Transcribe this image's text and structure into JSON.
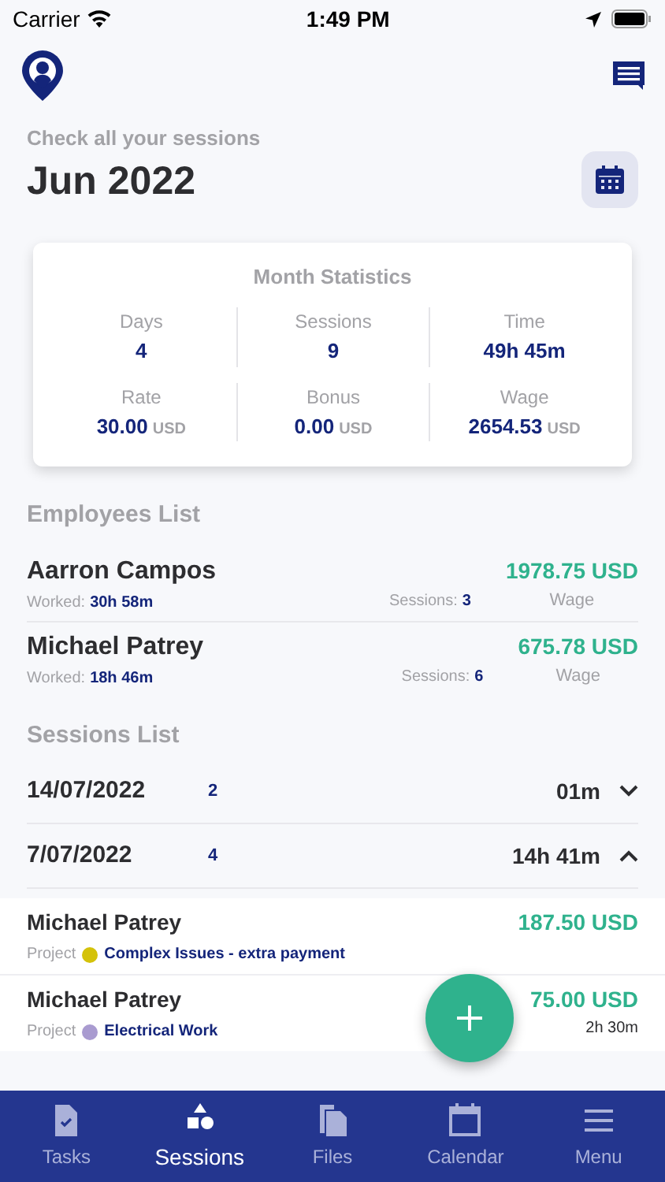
{
  "status_bar": {
    "carrier": "Carrier",
    "time": "1:49 PM"
  },
  "header": {
    "subtitle": "Check all your sessions",
    "title": "Jun 2022"
  },
  "month_statistics": {
    "title": "Month Statistics",
    "stats": [
      {
        "label": "Days",
        "value": "4"
      },
      {
        "label": "Sessions",
        "value": "9"
      },
      {
        "label": "Time",
        "value": "49h 45m"
      },
      {
        "label": "Rate",
        "value": "30.00",
        "unit": "USD"
      },
      {
        "label": "Bonus",
        "value": "0.00",
        "unit": "USD"
      },
      {
        "label": "Wage",
        "value": "2654.53",
        "unit": "USD"
      }
    ]
  },
  "employees": {
    "title": "Employees List",
    "rows": [
      {
        "name": "Aarron Campos",
        "worked_label": "Worked:",
        "worked": "30h 58m",
        "sessions_label": "Sessions:",
        "sessions": "3",
        "amount": "1978.75 USD",
        "amount_label": "Wage"
      },
      {
        "name": "Michael Patrey",
        "worked_label": "Worked:",
        "worked": "18h 46m",
        "sessions_label": "Sessions:",
        "sessions": "6",
        "amount": "675.78 USD",
        "amount_label": "Wage"
      }
    ]
  },
  "sessions": {
    "title": "Sessions List",
    "days": [
      {
        "date": "14/07/2022",
        "count": "2",
        "duration": "01m",
        "expanded": false
      },
      {
        "date": "7/07/2022",
        "count": "4",
        "duration": "14h 41m",
        "expanded": true
      }
    ],
    "entries": [
      {
        "name": "Michael Patrey",
        "project_label": "Project",
        "project": "Complex Issues - extra payment",
        "color": "#d4c20a",
        "amount": "187.50 USD"
      },
      {
        "name": "Michael Patrey",
        "project_label": "Project",
        "project": "Electrical Work",
        "color": "#a99bd0",
        "amount": "75.00 USD",
        "duration": "2h 30m"
      }
    ]
  },
  "tab_bar": [
    {
      "label": "Tasks",
      "kind": "tasks",
      "selected": false
    },
    {
      "label": "Sessions",
      "kind": "shapes",
      "selected": true
    },
    {
      "label": "Files",
      "kind": "files",
      "selected": false
    },
    {
      "label": "Calendar",
      "kind": "calendar",
      "selected": false
    },
    {
      "label": "Menu",
      "kind": "menu",
      "selected": false
    }
  ]
}
